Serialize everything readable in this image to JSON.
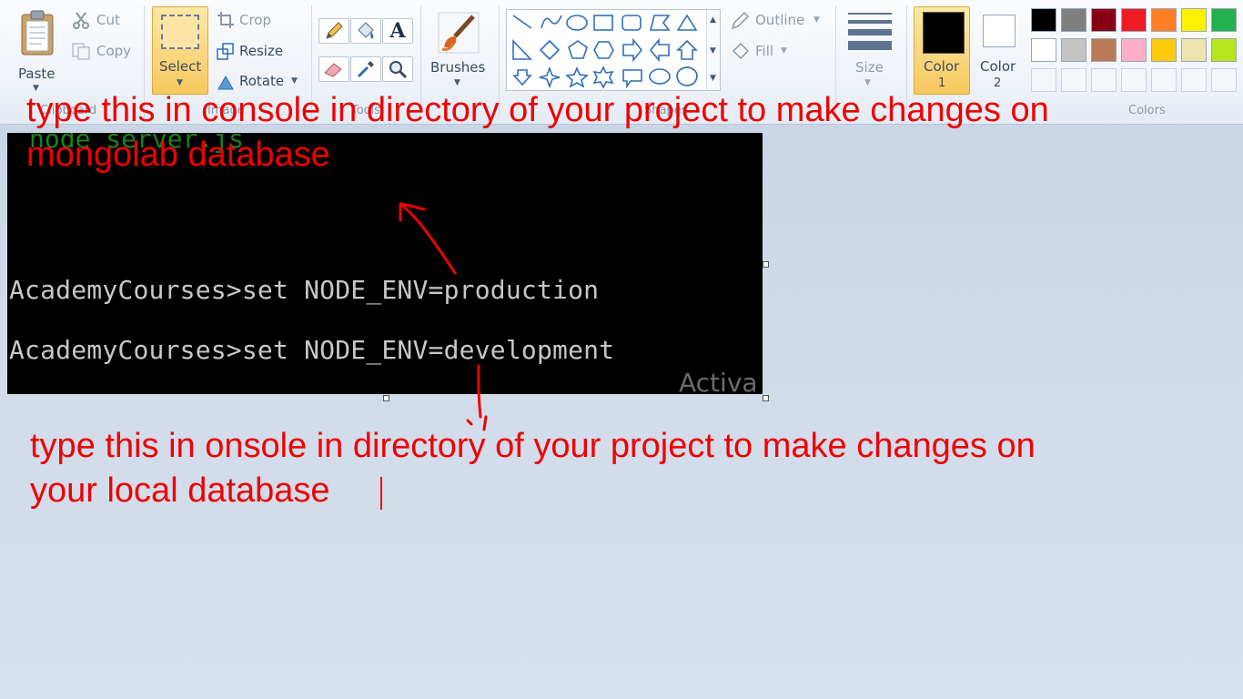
{
  "ribbon": {
    "clipboard": {
      "paste_label": "Paste",
      "cut_label": "Cut",
      "copy_label": "Copy",
      "group_label": "Clipboard"
    },
    "image": {
      "select_label": "Select",
      "crop_label": "Crop",
      "resize_label": "Resize",
      "rotate_label": "Rotate",
      "group_label": "Image"
    },
    "tools": {
      "group_label": "Tools",
      "items": [
        "pencil-icon",
        "fill-bucket-icon",
        "text-icon",
        "eraser-icon",
        "color-picker-icon",
        "magnifier-icon"
      ]
    },
    "brushes": {
      "label": "Brushes"
    },
    "shapes": {
      "group_label": "Shapes",
      "outline_label": "Outline",
      "fill_label": "Fill"
    },
    "size": {
      "label": "Size"
    },
    "colors": {
      "color1_label": "Color",
      "color1_num": "1",
      "color2_label": "Color",
      "color2_num": "2",
      "group_label": "Colors",
      "color1_value": "#000000",
      "color2_value": "#ffffff",
      "palette_row1": [
        "#000000",
        "#7f7f7f",
        "#880015",
        "#ed1c24",
        "#ff7f27",
        "#fff200",
        "#22b14c"
      ],
      "palette_row2": [
        "#ffffff",
        "#c3c3c3",
        "#b97a57",
        "#ffaec9",
        "#ffc90e",
        "#efe4b0",
        "#b5e61d"
      ]
    }
  },
  "canvas": {
    "console": {
      "green_line": "node server.js",
      "line1": "AcademyCourses>set NODE_ENV=production",
      "line2": "AcademyCourses>set NODE_ENV=development",
      "watermark": "Activa"
    },
    "annotation_top": {
      "line1": "type this in console in directory of your project to make changes on",
      "line2": "mongolab database"
    },
    "annotation_bottom": {
      "line1": "type this in onsole in directory of your project to make changes on",
      "line2": "your local database"
    },
    "annotation_color": "#ef0000"
  }
}
